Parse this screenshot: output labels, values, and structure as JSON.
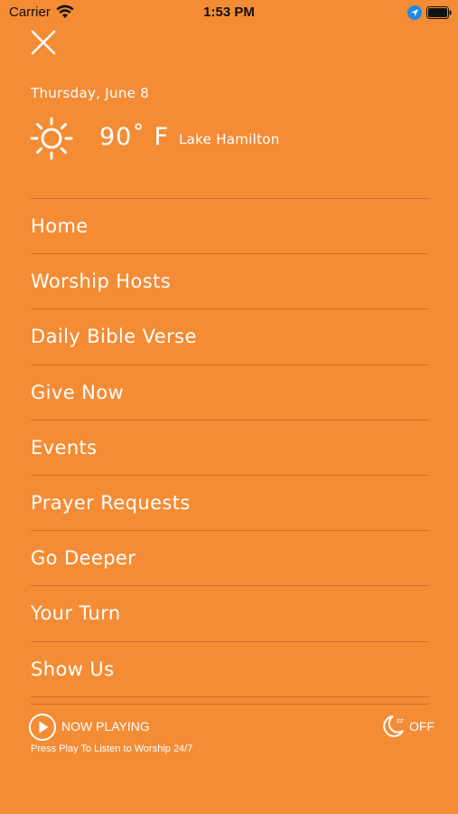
{
  "status_bar": {
    "carrier": "Carrier",
    "time": "1:53 PM"
  },
  "weather": {
    "date": "Thursday, June 8",
    "temperature": "90˚ F",
    "location": "Lake Hamilton",
    "icon": "sun-icon"
  },
  "menu": {
    "items": [
      {
        "label": "Home"
      },
      {
        "label": "Worship Hosts"
      },
      {
        "label": "Daily Bible Verse"
      },
      {
        "label": "Give Now"
      },
      {
        "label": "Events"
      },
      {
        "label": "Prayer Requests"
      },
      {
        "label": "Go Deeper"
      },
      {
        "label": "Your Turn"
      },
      {
        "label": "Show Us"
      }
    ]
  },
  "player": {
    "now_playing_label": "NOW PLAYING",
    "subtitle": "Press Play To Listen to Worship 24/7",
    "sleep_timer_label": "OFF"
  },
  "colors": {
    "background": "#f48c35",
    "text": "#ffffff"
  }
}
